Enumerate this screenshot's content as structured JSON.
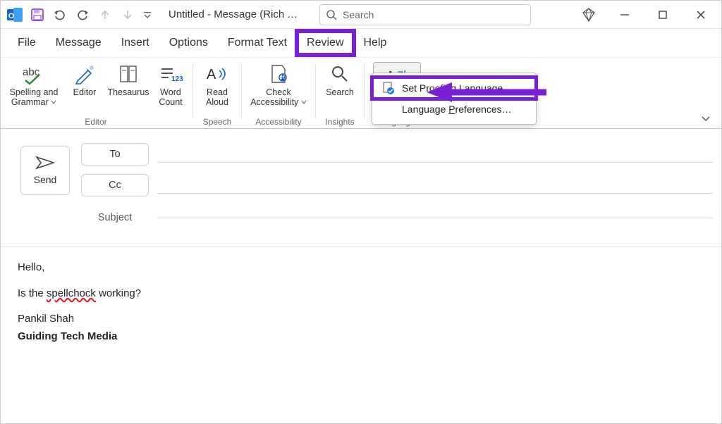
{
  "titlebar": {
    "title": "Untitled - Message (Rich T…",
    "search_placeholder": "Search"
  },
  "ribbon_tabs": [
    "File",
    "Message",
    "Insert",
    "Options",
    "Format Text",
    "Review",
    "Help"
  ],
  "active_tab": "Review",
  "ribbon": {
    "group_editor": {
      "label": "Editor",
      "spelling": "Spelling and\nGrammar",
      "editor": "Editor",
      "thesaurus": "Thesaurus",
      "wordcount": "Word\nCount"
    },
    "group_speech": {
      "label": "Speech",
      "read_aloud": "Read\nAloud"
    },
    "group_accessibility": {
      "label": "Accessibility",
      "check": "Check\nAccessibility"
    },
    "group_insights": {
      "label": "Insights",
      "search": "Search"
    },
    "group_language": {
      "label": "Language",
      "language": "Language"
    }
  },
  "language_menu": {
    "set_proofing": "Set Proofing Language…",
    "preferences": "Language Preferences…"
  },
  "compose": {
    "send": "Send",
    "to": "To",
    "cc": "Cc",
    "subject_label": "Subject"
  },
  "body": {
    "greeting": "Hello,",
    "line2_pre": "Is the ",
    "line2_word": "spellchock",
    "line2_post": " working?",
    "sig1": "Pankil Shah",
    "sig2": "Guiding Tech Media"
  }
}
